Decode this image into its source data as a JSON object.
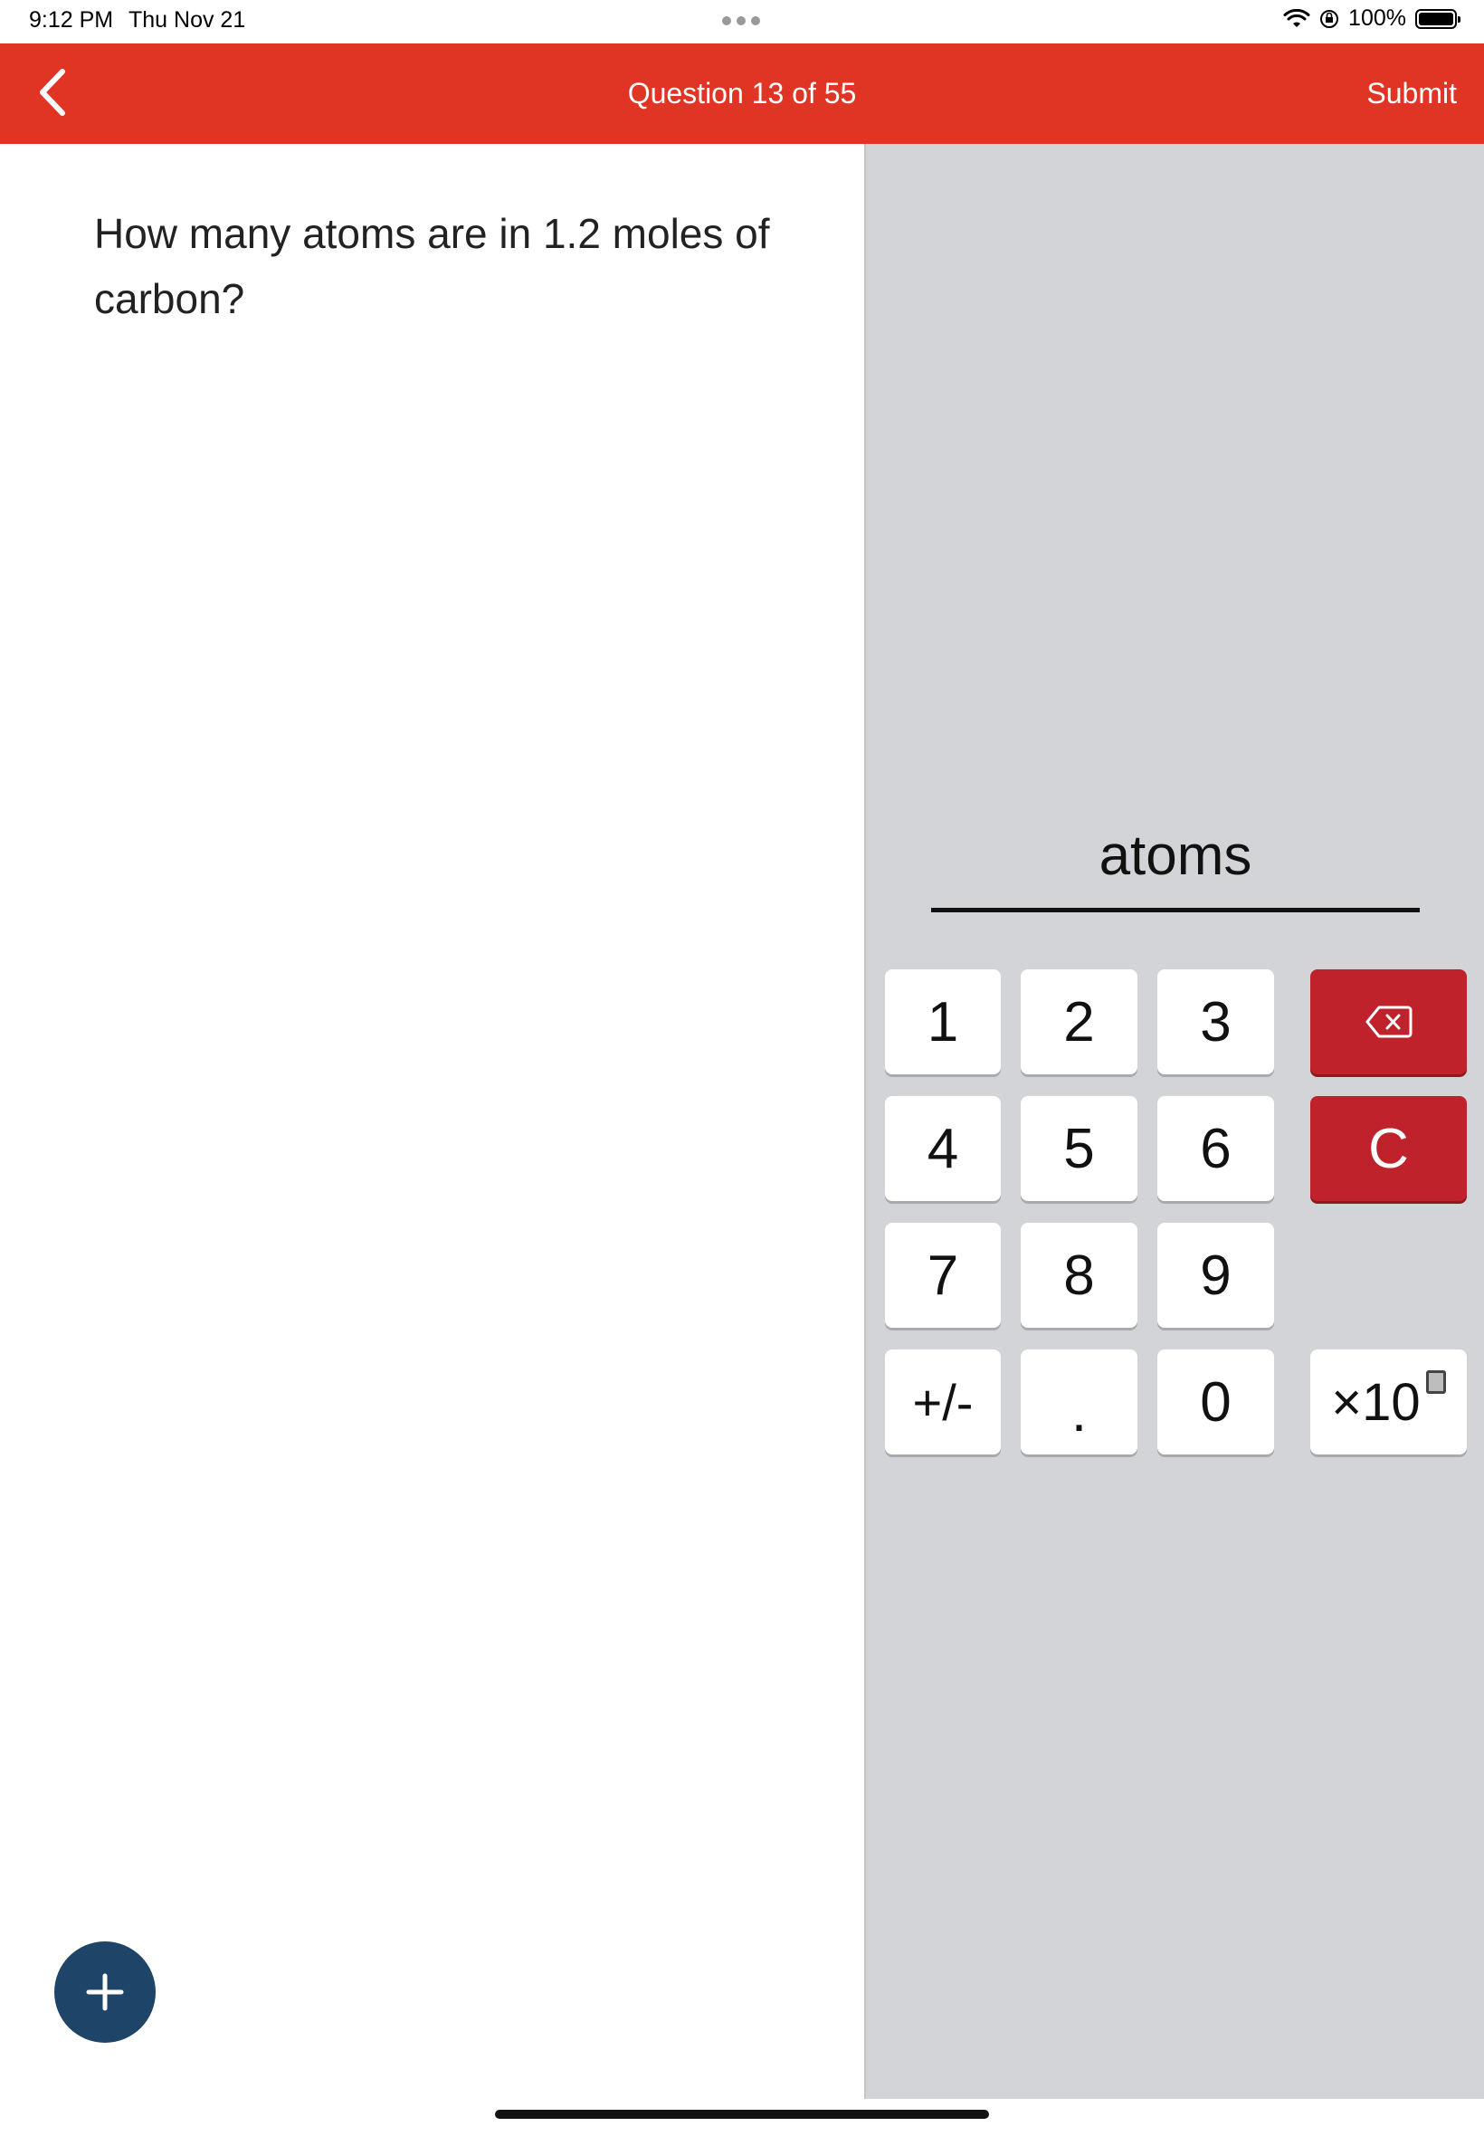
{
  "status_bar": {
    "time": "9:12 PM",
    "date": "Thu Nov 21",
    "battery": "100%"
  },
  "header": {
    "title": "Question 13 of 55",
    "submit_label": "Submit"
  },
  "question": {
    "text": "How many atoms are in 1.2 moles of carbon?"
  },
  "answer": {
    "unit": "atoms",
    "value": ""
  },
  "keypad": {
    "k1": "1",
    "k2": "2",
    "k3": "3",
    "k4": "4",
    "k5": "5",
    "k6": "6",
    "k7": "7",
    "k8": "8",
    "k9": "9",
    "plus_minus": "+/-",
    "decimal": ".",
    "k0": "0",
    "clear": "C",
    "sci": "×10"
  },
  "colors": {
    "header": "#e03524",
    "panel": "#d3d4d8",
    "danger_key": "#c0222b",
    "fab": "#1e4468"
  }
}
